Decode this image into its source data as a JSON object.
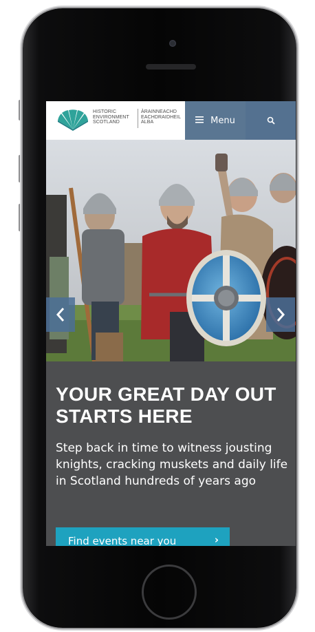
{
  "header": {
    "logo_en": [
      "HISTORIC",
      "ENVIRONMENT",
      "SCOTLAND"
    ],
    "logo_gd": [
      "ÀRAINNEACHD",
      "EACHDRAIDHEIL",
      "ALBA"
    ],
    "menu_label": "Menu",
    "menu_icon": "hamburger-icon",
    "search_icon": "search-icon"
  },
  "hero": {
    "prev_icon": "chevron-left-icon",
    "next_icon": "chevron-right-icon"
  },
  "content": {
    "headline": "YOUR GREAT DAY OUT STARTS HERE",
    "intro": "Step back in time to witness jousting knights, cracking muskets and daily life in Scotland hundreds of years ago",
    "cta_label": "Find events near you",
    "cta_icon": "chevron-right-icon"
  },
  "colors": {
    "nav_blue": "#5a7692",
    "content_bg": "#4d4e50",
    "cta": "#1ea2bf",
    "logo_teal": "#2fa39a"
  }
}
